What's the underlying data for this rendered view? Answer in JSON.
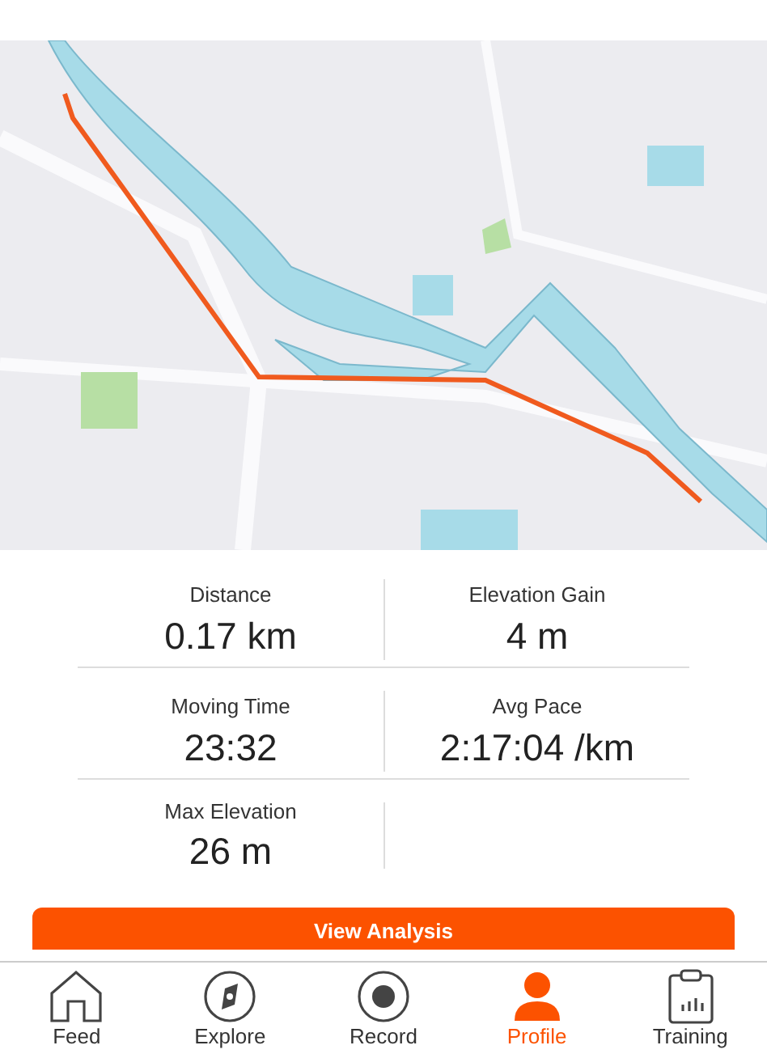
{
  "stats": [
    {
      "label": "Distance",
      "value": "0.17 km"
    },
    {
      "label": "Elevation Gain",
      "value": "4 m"
    },
    {
      "label": "Moving Time",
      "value": "23:32"
    },
    {
      "label": "Avg Pace",
      "value": "2:17:04 /km"
    },
    {
      "label": "Max Elevation",
      "value": "26 m"
    }
  ],
  "analysis_button": "View Analysis",
  "nav": [
    {
      "label": "Feed",
      "selected": false
    },
    {
      "label": "Explore",
      "selected": false
    },
    {
      "label": "Record",
      "selected": false
    },
    {
      "label": "Profile",
      "selected": true
    },
    {
      "label": "Training",
      "selected": false
    }
  ]
}
